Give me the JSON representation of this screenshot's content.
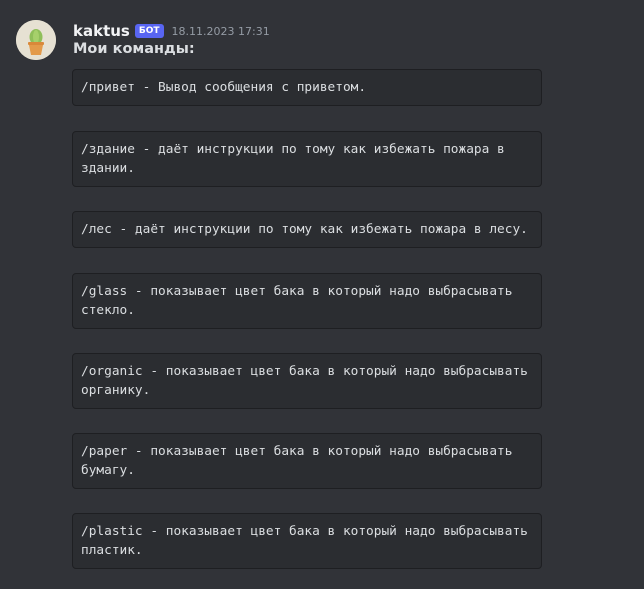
{
  "message": {
    "author": "kaktus",
    "badge": "БОТ",
    "timestamp": "18.11.2023 17:31",
    "intro": "Мои команды:",
    "avatar_icon": "cactus-pot-icon",
    "code_blocks": [
      "/привет - Вывод сообщения с приветом.",
      "/здание - даёт инструкции по тому как избежать пожара в\nздании.",
      "/лес - даёт инструкции по тому как избежать пожара в лесу.",
      "/glass - показывает цвет бака в который надо выбрасывать\nстекло.",
      "/organic - показывает цвет бака в который надо выбрасывать\nорганику.",
      "/paper - показывает цвет бака в который надо выбрасывать\nбумагу.",
      "/plastic - показывает цвет бака в который надо выбрасывать\nпластик."
    ]
  },
  "colors": {
    "background": "#313338",
    "code_background": "#2b2d31",
    "badge": "#5865f2"
  }
}
